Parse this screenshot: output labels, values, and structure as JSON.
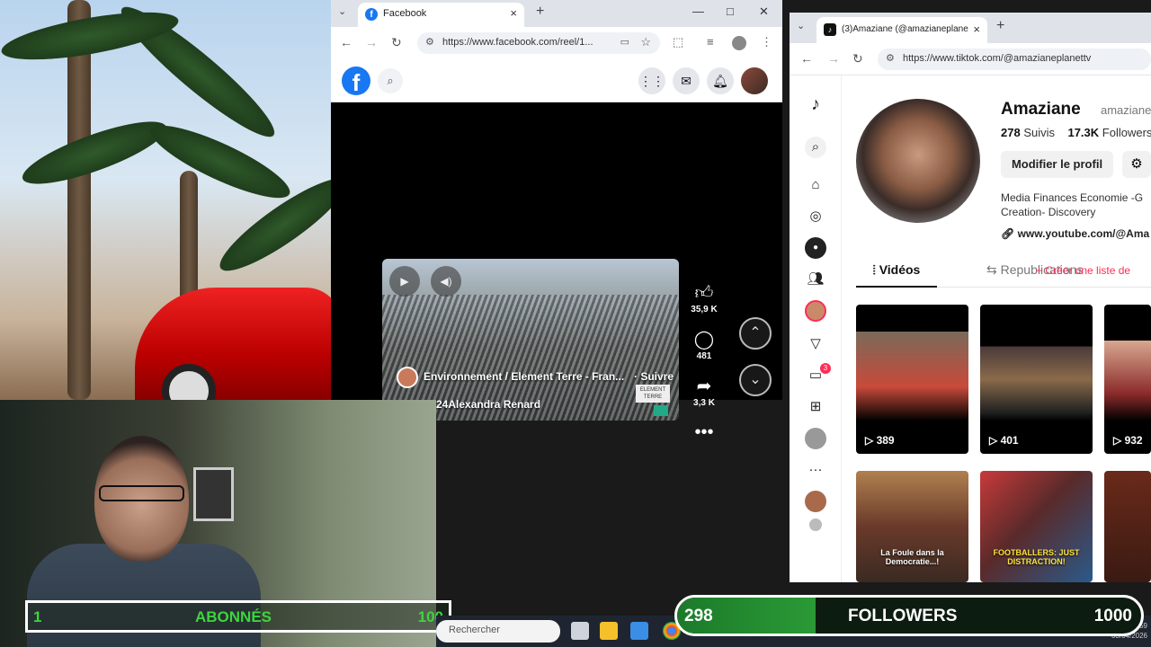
{
  "facebook": {
    "tab_title": "Facebook",
    "tab_icon": "f",
    "url": "https://www.facebook.com/reel/1...",
    "logo": "f",
    "reel": {
      "channel": "Environnement / Element Terre - Fran...",
      "follow": "· Suivre",
      "author": "24Alexandra Renard",
      "badge": "ELEMENT TERRE"
    },
    "actions": {
      "likes": "35,9 K",
      "comments": "481",
      "shares": "3,3 K"
    }
  },
  "tiktok": {
    "tab_title": "(3)Amaziane (@amazianeplane",
    "tab_icon": "♪",
    "url": "https://www.tiktok.com/@amazianeplanettv",
    "notif_count": "3",
    "name": "Amaziane",
    "handle": "amaziane",
    "following_count": "278",
    "following_label": "Suivis",
    "followers_count": "17.3K",
    "followers_label": "Followers",
    "edit_button": "Modifier le profil",
    "bio": "Media Finances Economie -G Creation- Discovery",
    "link": "www.youtube.com/@Ama",
    "tabs": {
      "videos": "Vidéos",
      "reposts": "Republications",
      "list": "+ Créer une liste de"
    },
    "videos": [
      {
        "count": "389",
        "caption": "",
        "caption2": "",
        "color": "#6a4a3a"
      },
      {
        "count": "401",
        "caption": "",
        "caption2": "",
        "color": "#3a3030"
      },
      {
        "count": "932",
        "caption": "",
        "caption2": "",
        "color": "#8a6a5a"
      },
      {
        "count": "",
        "caption": "La Foule dans la Democratie...!",
        "caption2": "",
        "color": "#7a5a3a"
      },
      {
        "count": "",
        "caption": "FOOTBALLERS: JUST DISTRACTION!",
        "caption2": "",
        "color": "#2a4a6a"
      },
      {
        "count": "",
        "caption": "",
        "caption2": "",
        "color": "#5a2a1a"
      }
    ]
  },
  "overlay": {
    "subscribers": {
      "current": "1",
      "label": "ABONNÉS",
      "goal": "100"
    },
    "followers": {
      "current": "298",
      "label": "FOLLOWERS",
      "goal": "1000",
      "progress": 0.298
    }
  },
  "taskbar": {
    "search_placeholder": "Rechercher",
    "time": "23:59",
    "date": "03/04/2026"
  }
}
